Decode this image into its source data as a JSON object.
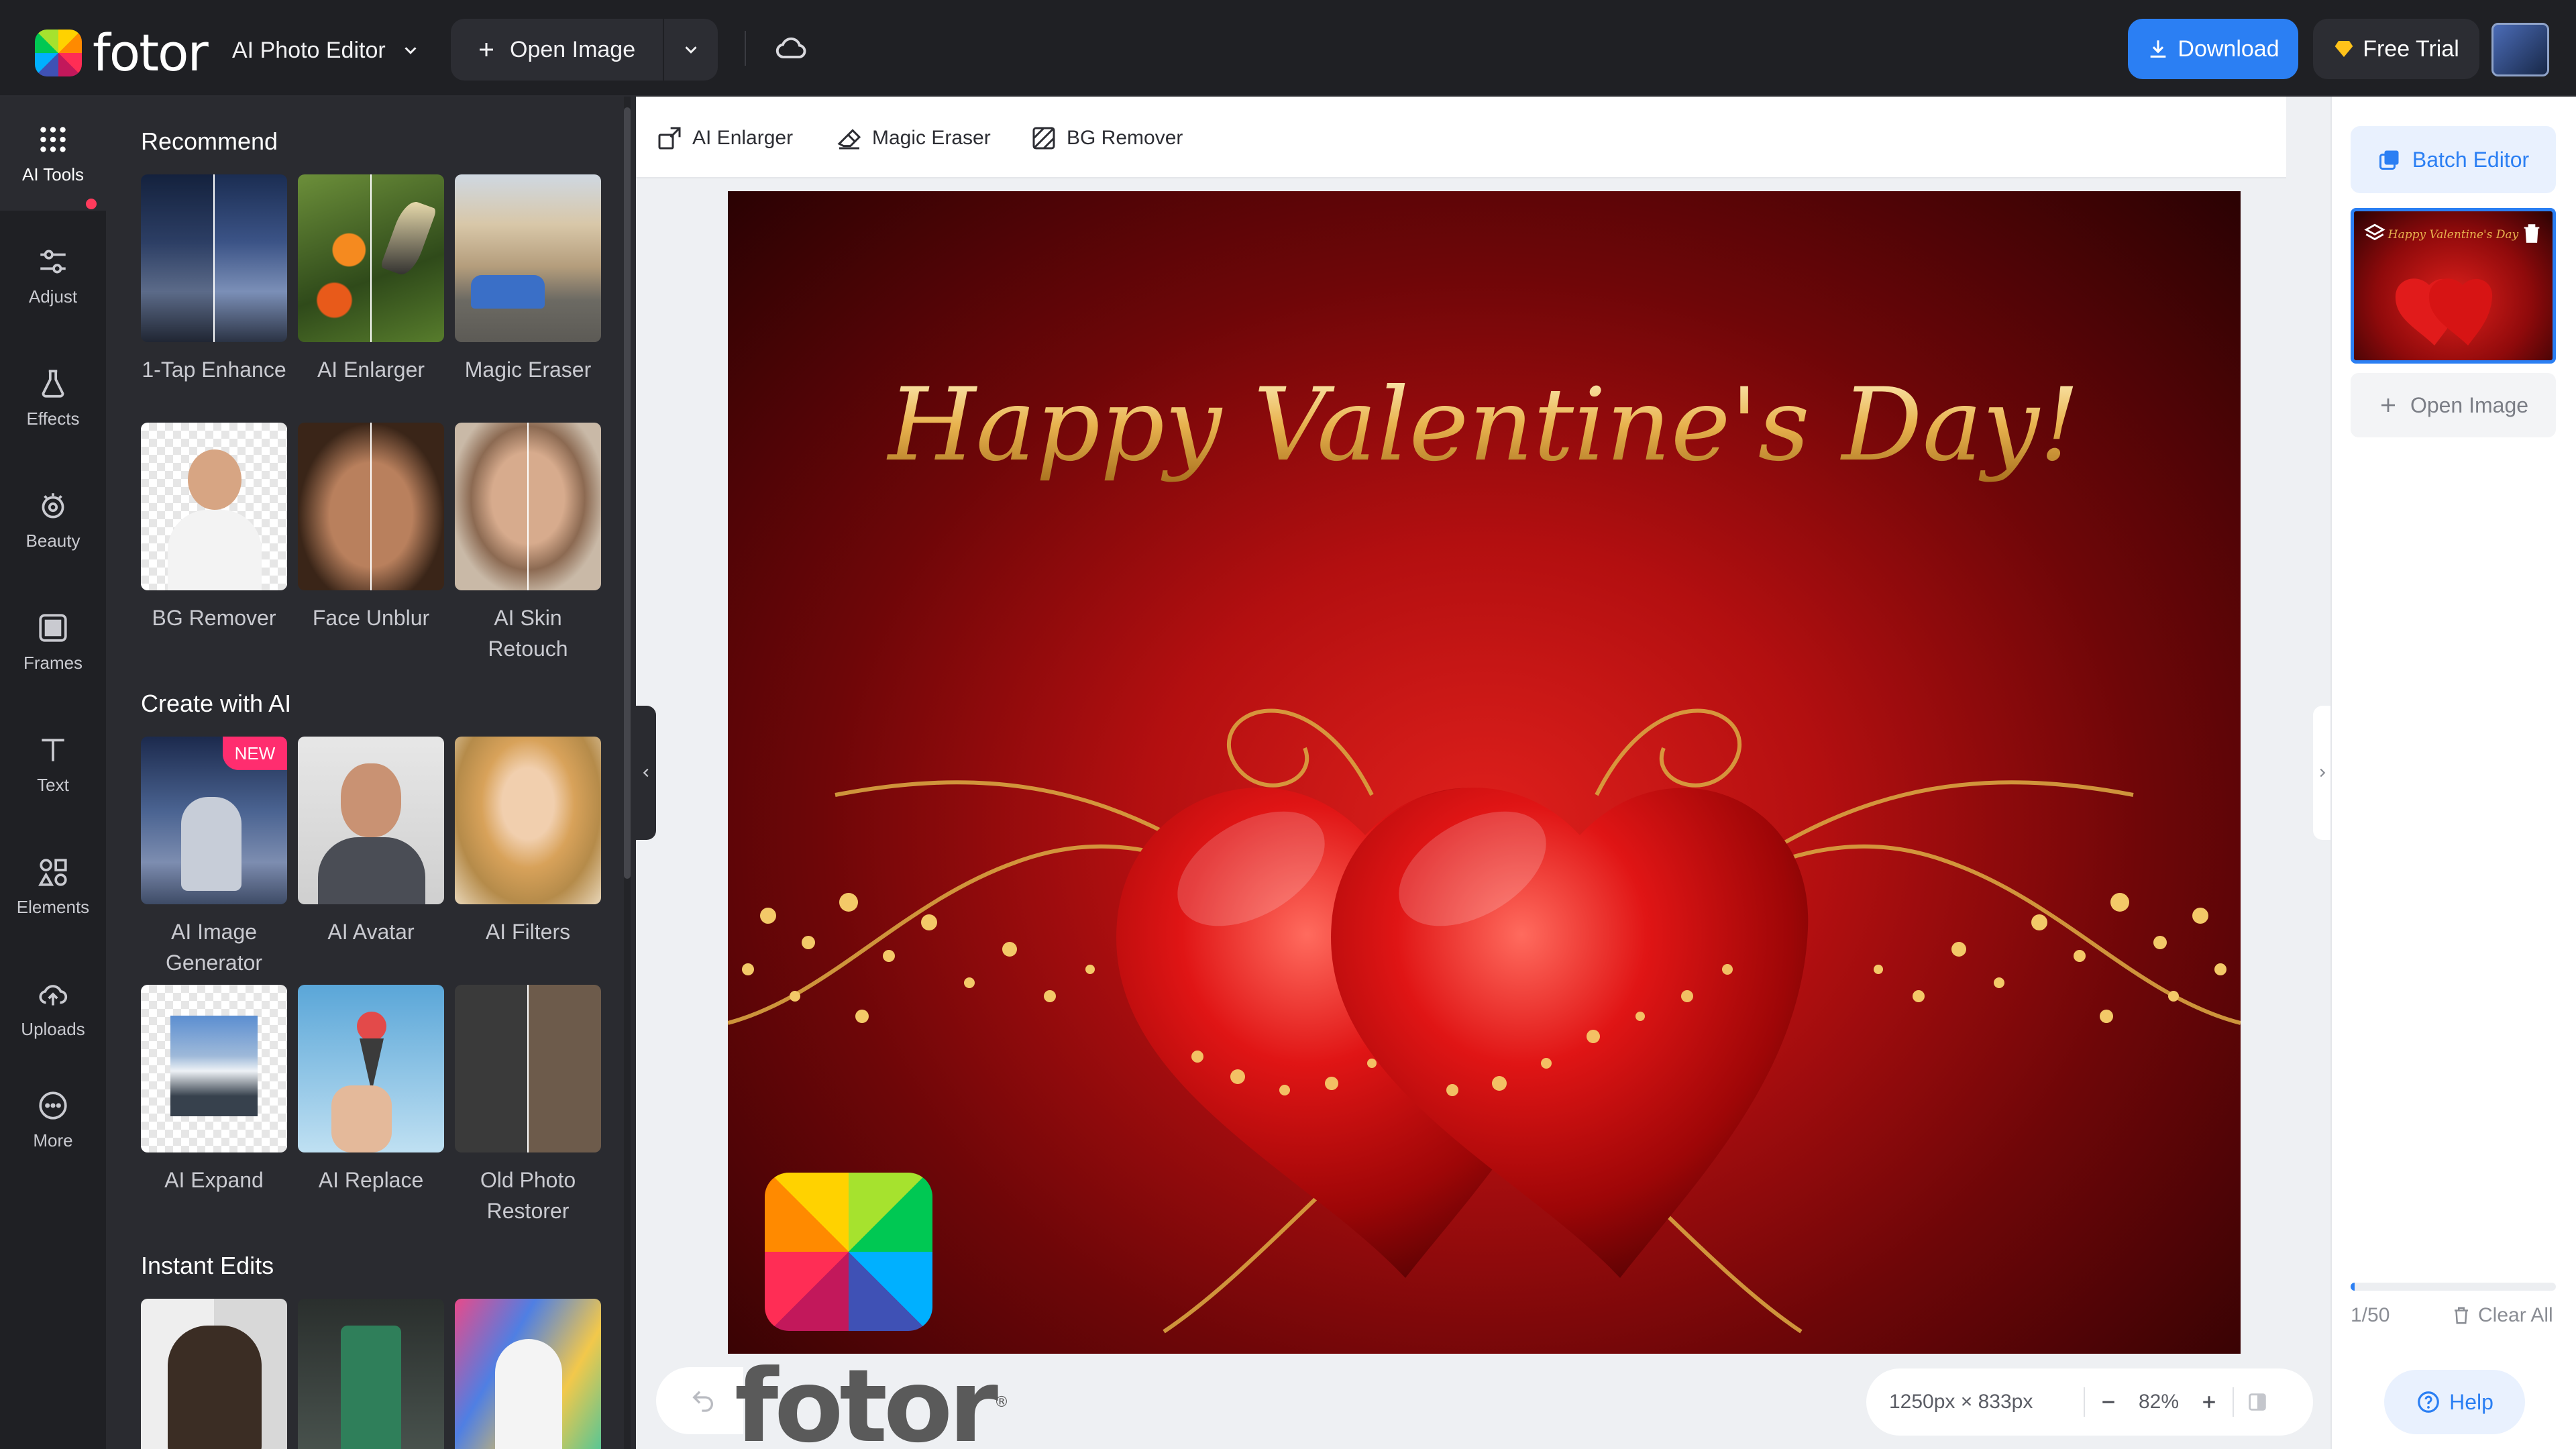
{
  "app": {
    "logo_text": "fotor",
    "editor_mode": "AI Photo Editor"
  },
  "topbar": {
    "open_image": "Open Image",
    "download": "Download",
    "free_trial": "Free Trial"
  },
  "rail": [
    {
      "label": "AI Tools",
      "icon": "grid-dots-icon",
      "active": true
    },
    {
      "label": "Adjust",
      "icon": "sliders-icon"
    },
    {
      "label": "Effects",
      "icon": "flask-icon"
    },
    {
      "label": "Beauty",
      "icon": "eye-icon"
    },
    {
      "label": "Frames",
      "icon": "frame-icon"
    },
    {
      "label": "Text",
      "icon": "text-icon"
    },
    {
      "label": "Elements",
      "icon": "shapes-icon"
    },
    {
      "label": "Uploads",
      "icon": "upload-cloud-icon"
    },
    {
      "label": "More",
      "icon": "more-dots-icon"
    }
  ],
  "panel": {
    "sections": [
      {
        "title": "Recommend",
        "tiles": [
          {
            "label": "1-Tap Enhance"
          },
          {
            "label": "AI Enlarger"
          },
          {
            "label": "Magic Eraser"
          },
          {
            "label": "BG Remover"
          },
          {
            "label": "Face Unblur"
          },
          {
            "label": "AI Skin Retouch"
          }
        ]
      },
      {
        "title": "Create with AI",
        "tiles": [
          {
            "label": "AI Image Generator",
            "badge": "NEW"
          },
          {
            "label": "AI Avatar"
          },
          {
            "label": "AI Filters"
          },
          {
            "label": "AI Expand"
          },
          {
            "label": "AI Replace"
          },
          {
            "label": "Old Photo Restorer"
          }
        ]
      },
      {
        "title": "Instant Edits",
        "tiles": [
          {
            "label": ""
          },
          {
            "label": ""
          },
          {
            "label": ""
          }
        ]
      }
    ]
  },
  "subtoolbar": [
    {
      "label": "AI Enlarger",
      "icon": "enlarge-icon"
    },
    {
      "label": "Magic Eraser",
      "icon": "eraser-icon"
    },
    {
      "label": "BG Remover",
      "icon": "bg-remove-icon"
    }
  ],
  "canvas": {
    "greeting": "Happy Valentine's Day!",
    "watermark": "fotor",
    "watermark_mark": "®"
  },
  "thumb": {
    "greeting": "Happy Valentine's Day"
  },
  "zoom": {
    "dimensions": "1250px × 833px",
    "level": "82%"
  },
  "right_panel": {
    "batch_editor": "Batch Editor",
    "open_image": "Open Image",
    "count": "1/50",
    "clear_all": "Clear All",
    "help": "Help",
    "progress": 0.02
  },
  "colors": {
    "accent": "#2b7ff3",
    "topbar": "#1f2024",
    "panel": "#2a2b30",
    "canvas_bg": "#eef0f3",
    "badge": "#ff2d6f"
  }
}
